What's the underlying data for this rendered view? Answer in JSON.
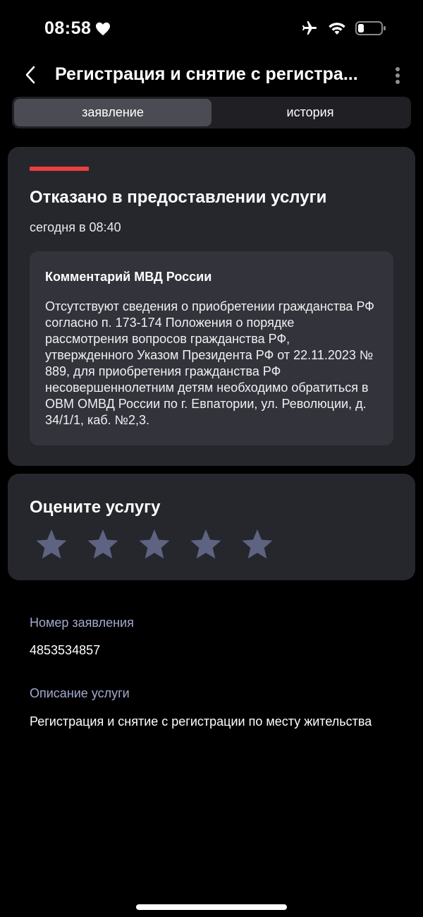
{
  "status_bar": {
    "time": "08:58"
  },
  "header": {
    "title": "Регистрация и снятие с регистра..."
  },
  "tabs": [
    {
      "label": "заявление",
      "active": true
    },
    {
      "label": "история",
      "active": false
    }
  ],
  "status_card": {
    "accent_color": "#e8403f",
    "title": "Отказано в предоставлении услуги",
    "time": "сегодня в 08:40",
    "comment": {
      "author": "Комментарий МВД России",
      "text": "Отсутствуют сведения о приобретении гражданства РФ согласно п. 173-174 Положения о порядке рассмотрения вопросов гражданства РФ, утвержденного Указом Президента РФ от 22.11.2023 № 889, для приобретения гражданства РФ несовершеннолетним детям необходимо обратиться в ОВМ ОМВД России по г. Евпатории, ул. Революции, д. 34/1/1, каб. №2,3."
    }
  },
  "rating": {
    "title": "Оцените услугу",
    "max_stars": 5,
    "selected": 0,
    "star_color": "#5d6380"
  },
  "info": {
    "number_label": "Номер заявления",
    "number_value": "4853534857",
    "description_label": "Описание услуги",
    "description_value": "Регистрация и снятие с регистрации по месту жительства"
  }
}
